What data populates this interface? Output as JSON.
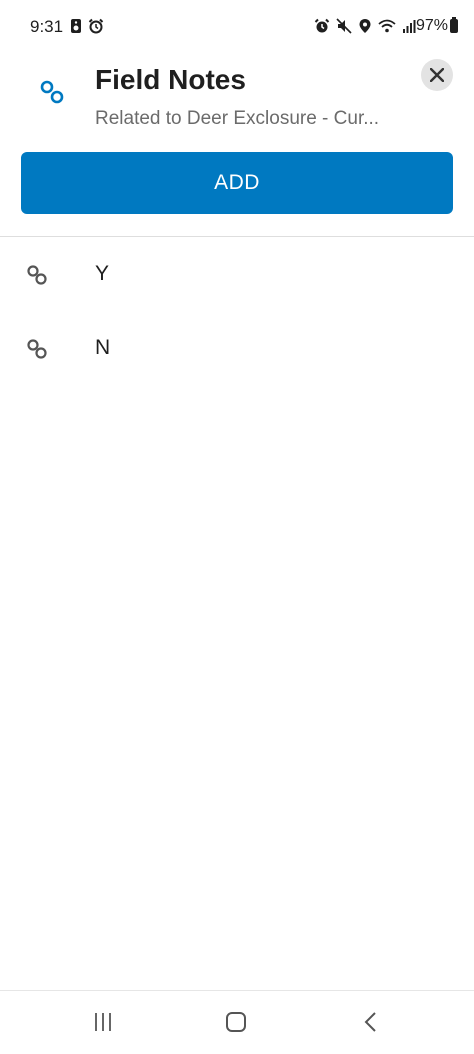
{
  "status_bar": {
    "time": "9:31",
    "battery": "97%"
  },
  "header": {
    "title": "Field Notes",
    "subtitle": "Related to Deer Exclosure - Cur...",
    "icon": "link-icon",
    "close_icon": "close-icon"
  },
  "add_button": {
    "label": "ADD"
  },
  "records": [
    {
      "label": "Y",
      "icon": "link-icon"
    },
    {
      "label": "N",
      "icon": "link-icon"
    }
  ],
  "colors": {
    "accent": "#0079c1",
    "close_bg": "#e3e3e3",
    "subtitle": "#6b6b6b"
  },
  "nav_bar": {
    "recent_icon": "recent-apps-icon",
    "home_icon": "home-icon",
    "back_icon": "back-icon"
  }
}
